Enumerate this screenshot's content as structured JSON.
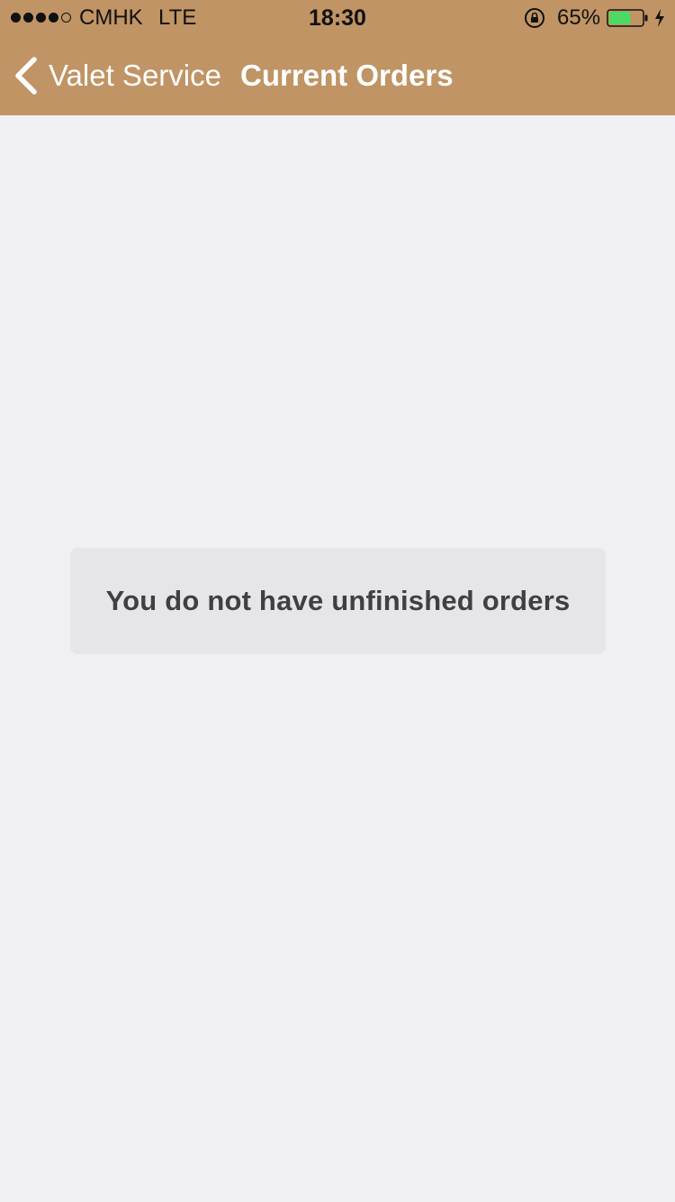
{
  "status_bar": {
    "signal_bars_filled": 4,
    "signal_bars_total": 5,
    "carrier": "CMHK",
    "network": "LTE",
    "time": "18:30",
    "orientation_lock_icon": "orientation-lock-icon",
    "battery_percent": "65%",
    "battery_level": 0.65,
    "charging_icon": "bolt-icon",
    "battery_color": "#4cd964"
  },
  "nav": {
    "back_label": "Valet Service",
    "back_icon": "chevron-left-icon",
    "title": "Current Orders",
    "background_color": "#c09464"
  },
  "main": {
    "empty_message": "You do not have unfinished orders",
    "background_color": "#efeff4"
  }
}
